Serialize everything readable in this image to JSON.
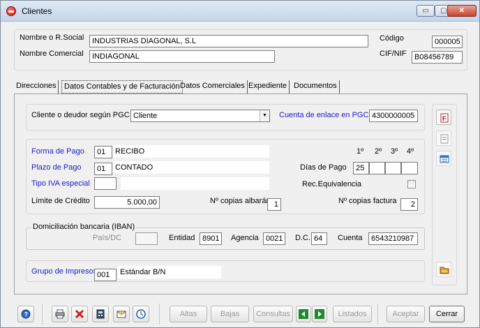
{
  "window": {
    "title": "Clientes",
    "minimize": "▭",
    "maximize": "▢",
    "close": "✕"
  },
  "header": {
    "nombre_label": "Nombre o R.Social",
    "nombre_value": "INDUSTRIAS DIAGONAL, S.L",
    "comercial_label": "Nombre Comercial",
    "comercial_value": "INDIAGONAL",
    "codigo_label": "Código",
    "codigo_value": "000005",
    "cif_label": "CIF/NIF",
    "cif_value": "B08456789"
  },
  "tabs": [
    {
      "label": "Direcciones"
    },
    {
      "label": "Datos Contables y de Facturación"
    },
    {
      "label": "Datos Comerciales"
    },
    {
      "label": "Expediente"
    },
    {
      "label": "Documentos"
    }
  ],
  "pgc": {
    "label": "Cliente o deudor según PGC",
    "value": "Cliente",
    "enlace_label": "Cuenta de enlace en PGC",
    "enlace_value": "4300000005"
  },
  "pago": {
    "forma_label": "Forma de Pago",
    "forma_code": "01",
    "forma_desc": "RECIBO",
    "plazo_label": "Plazo de Pago",
    "plazo_code": "01",
    "plazo_desc": "CONTADO",
    "iva_label": "Tipo IVA especial",
    "iva_code": "",
    "iva_desc": "",
    "limite_label": "Límite de Crédito",
    "limite_value": "5.000,00",
    "dias_headers": [
      "1º",
      "2º",
      "3º",
      "4º"
    ],
    "dias_label": "Días de Pago",
    "dias_values": [
      "25",
      "",
      "",
      ""
    ],
    "receq_label": "Rec.Equivalencia",
    "albaran_label": "Nº copias albarán",
    "albaran_value": "1",
    "factura_label": "Nº copias factura",
    "factura_value": "2"
  },
  "banco": {
    "title": "Domiciliación bancaria (IBAN)",
    "pais_label": "País/DC",
    "pais_value": "",
    "entidad_label": "Entidad",
    "entidad_value": "8901",
    "agencia_label": "Agencia",
    "agencia_value": "0021",
    "dc_label": "D.C.",
    "dc_value": "64",
    "cuenta_label": "Cuenta",
    "cuenta_value": "6543210987"
  },
  "impresos": {
    "label": "Grupo de Impresos",
    "code": "001",
    "desc": "Estándar B/N"
  },
  "toolbar": {
    "altas": "Altas",
    "bajas": "Bajas",
    "consultas": "Consultas",
    "listados": "Listados",
    "aceptar": "Aceptar",
    "cerrar": "Cerrar"
  },
  "colors": {
    "link_blue": "#1a1ad0",
    "titlebar": "#c4d5ea",
    "close_red": "#c7432c"
  }
}
